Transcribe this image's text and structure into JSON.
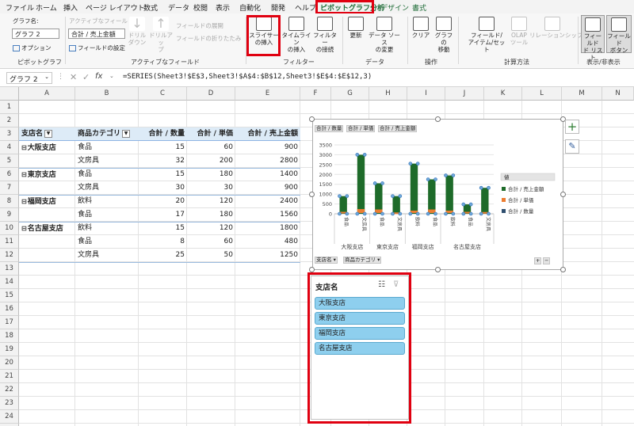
{
  "menu": {
    "tabs": [
      "ファイル",
      "ホーム",
      "挿入",
      "ページ レイアウト",
      "数式",
      "データ",
      "校閲",
      "表示",
      "自動化",
      "開発",
      "ヘルプ",
      "ピボットグラフ分析",
      "デザイン",
      "書式"
    ]
  },
  "ribbon": {
    "chart_name_label": "グラフ名:",
    "chart_name_value": "グラフ 2",
    "options": "オプション",
    "group_pivotchart": "ピボットグラフ",
    "active_field_label": "アクティブなフィールド:",
    "active_field_value": "合計 / 売上金額",
    "field_settings": "フィールドの設定",
    "drill_down": "ドリル\nダウン",
    "drill_up": "ドリルアッ\nプ",
    "expand_field": "フィールドの展開",
    "collapse_field": "フィールドの折りたたみ",
    "group_active_field": "アクティブなフィールド",
    "insert_slicer": "スライサー\nの挿入",
    "insert_timeline": "タイムライン\nの挿入",
    "filter_connections": "フィルター\nの接続",
    "group_filter": "フィルター",
    "refresh": "更新",
    "change_source": "データ ソース\nの変更",
    "group_data": "データ",
    "clear": "クリア",
    "move_chart": "グラフの\n移動",
    "group_actions": "操作",
    "fields_items_sets": "フィールド/\nアイテム/セット",
    "olap_tools": "OLAP\nツール",
    "relationships": "リレーションシップ",
    "group_calculations": "計算方法",
    "field_list": "フィールド\nド リスト",
    "field_buttons": "フィールド\nボタン",
    "group_show_hide": "表示/非表示"
  },
  "formula_bar": {
    "name_box": "グラフ 2",
    "fx": "fx",
    "formula": "=SERIES(Sheet3!$E$3,Sheet3!$A$4:$B$12,Sheet3!$E$4:$E$12,3)"
  },
  "columns": [
    "A",
    "B",
    "C",
    "D",
    "E",
    "F",
    "G",
    "H",
    "I",
    "J",
    "K",
    "L",
    "M",
    "N"
  ],
  "rows": [
    "1",
    "2",
    "3",
    "4",
    "5",
    "6",
    "7",
    "8",
    "9",
    "10",
    "11",
    "12",
    "13",
    "14",
    "15",
    "16",
    "17",
    "18",
    "19",
    "20",
    "21",
    "22",
    "23",
    "24",
    "25"
  ],
  "pivot": {
    "headers": [
      "支店名",
      "商品カテゴリ",
      "合計 / 数量",
      "合計 / 単価",
      "合計 / 売上金額"
    ],
    "rows": [
      {
        "branch": "大阪支店",
        "category": "食品",
        "qty": "15",
        "price": "60",
        "sales": "900"
      },
      {
        "branch": "",
        "category": "文房具",
        "qty": "32",
        "price": "200",
        "sales": "2800"
      },
      {
        "branch": "東京支店",
        "category": "食品",
        "qty": "15",
        "price": "180",
        "sales": "1400"
      },
      {
        "branch": "",
        "category": "文房具",
        "qty": "30",
        "price": "30",
        "sales": "900"
      },
      {
        "branch": "福岡支店",
        "category": "飲料",
        "qty": "20",
        "price": "120",
        "sales": "2400"
      },
      {
        "branch": "",
        "category": "食品",
        "qty": "17",
        "price": "180",
        "sales": "1560"
      },
      {
        "branch": "名古屋支店",
        "category": "飲料",
        "qty": "15",
        "price": "120",
        "sales": "1800"
      },
      {
        "branch": "",
        "category": "食品",
        "qty": "8",
        "price": "60",
        "sales": "480"
      },
      {
        "branch": "",
        "category": "文房具",
        "qty": "25",
        "price": "50",
        "sales": "1250"
      }
    ]
  },
  "chart_data": {
    "type": "bar",
    "field_buttons": [
      "合計 / 数量",
      "合計 / 単価",
      "合計 / 売上金額"
    ],
    "axis_buttons": [
      "支店名",
      "商品カテゴリ"
    ],
    "ylim": [
      0,
      3500
    ],
    "yticks": [
      "0",
      "500",
      "1000",
      "1500",
      "2000",
      "2500",
      "3000",
      "3500"
    ],
    "categories": [
      "食品",
      "文房具",
      "食品",
      "文房具",
      "飲料",
      "食品",
      "飲料",
      "食品",
      "文房具"
    ],
    "groups": [
      {
        "label": "大阪支店",
        "count": 2
      },
      {
        "label": "東京支店",
        "count": 2
      },
      {
        "label": "福岡支店",
        "count": 2
      },
      {
        "label": "名古屋支店",
        "count": 3
      }
    ],
    "legend_title": "値",
    "series": [
      {
        "name": "合計 / 売上金額",
        "color": "#1e6b2a",
        "values": [
          900,
          3000,
          1550,
          900,
          2550,
          1750,
          1950,
          480,
          1320
        ]
      },
      {
        "name": "合計 / 単価",
        "color": "#ed7d31",
        "values": [
          60,
          200,
          180,
          30,
          120,
          180,
          120,
          60,
          50
        ]
      },
      {
        "name": "合計 / 数量",
        "color": "#2f4f6f",
        "values": [
          15,
          32,
          15,
          30,
          20,
          17,
          15,
          8,
          25
        ]
      }
    ],
    "grid": true,
    "legend_position": "right"
  },
  "slicer": {
    "title": "支店名",
    "items": [
      "大阪支店",
      "東京支店",
      "福岡支店",
      "名古屋支店"
    ],
    "item_color": "#8ecfee"
  }
}
